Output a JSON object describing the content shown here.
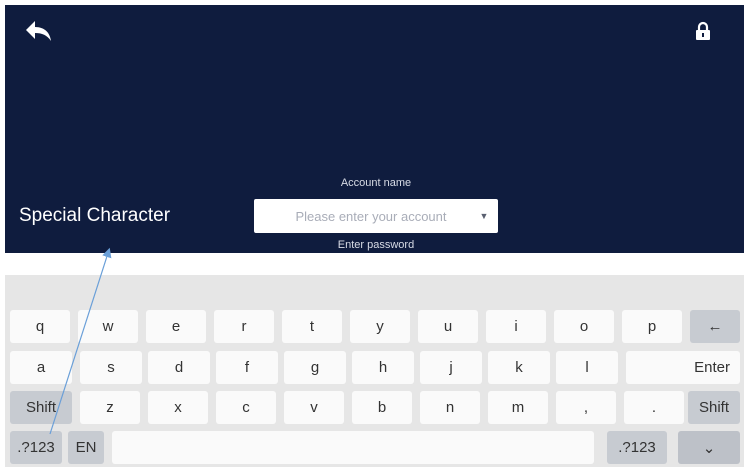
{
  "header": {
    "back_icon": "back-arrow-icon",
    "lock_icon": "lock-icon"
  },
  "form": {
    "account_label": "Account name",
    "account_placeholder": "Please enter your account",
    "password_label": "Enter password"
  },
  "annotation": {
    "text": "Special Character"
  },
  "keyboard": {
    "row1": [
      "q",
      "w",
      "e",
      "r",
      "t",
      "y",
      "u",
      "i",
      "o",
      "p",
      "←"
    ],
    "row2": [
      "a",
      "s",
      "d",
      "f",
      "g",
      "h",
      "j",
      "k",
      "l",
      "Enter"
    ],
    "row3": [
      "Shift",
      "z",
      "x",
      "c",
      "v",
      "b",
      "n",
      "m",
      ",",
      ".",
      "Shift"
    ],
    "row4": [
      ".?123",
      "EN",
      "",
      ".?123",
      "⌄"
    ]
  },
  "colors": {
    "screen_bg": "#0f1c3e",
    "keyboard_bg": "#e6e6e6",
    "key_bg": "#fafafa",
    "special_key_bg": "#c7cbd1",
    "annotation_arrow": "#6a9fd8"
  }
}
